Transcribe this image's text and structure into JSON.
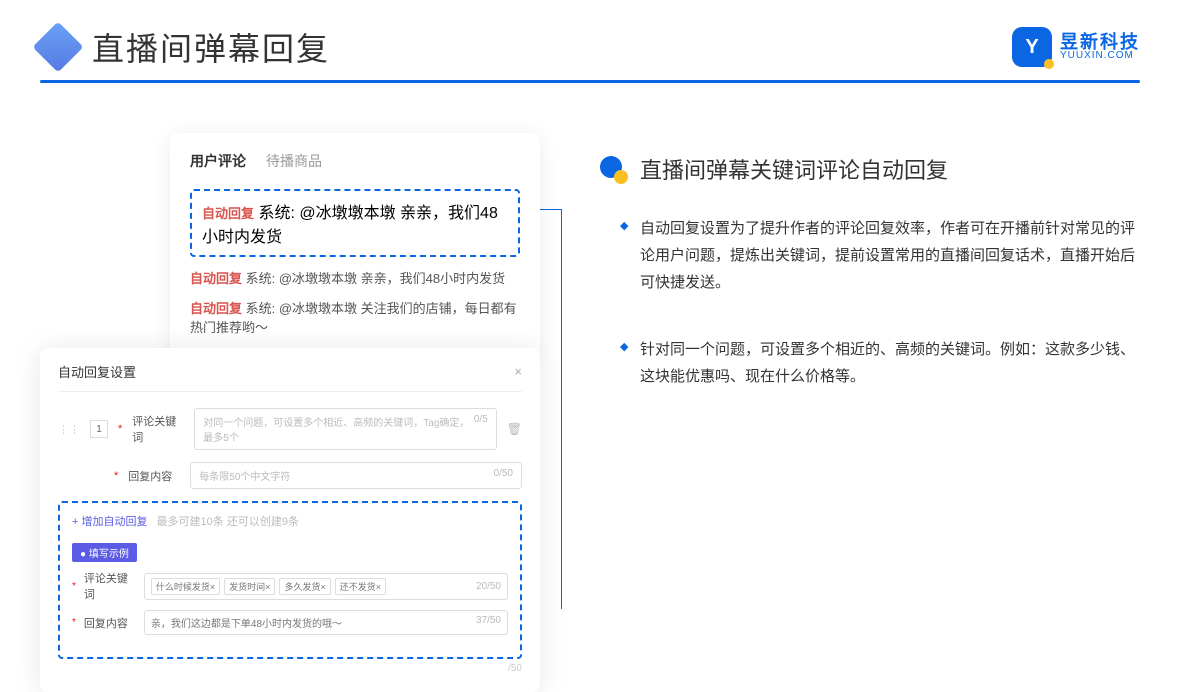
{
  "header": {
    "title": "直播间弹幕回复",
    "logo_cn": "昱新科技",
    "logo_en": "YUUXIN.COM",
    "logo_letter": "Y"
  },
  "cardTop": {
    "tab_active": "用户评论",
    "tab_inactive": "待播商品",
    "dashed_badge": "自动回复",
    "dashed_text": "系统: @冰墩墩本墩 亲亲，我们48小时内发货",
    "line2_badge": "自动回复",
    "line2_text": "系统: @冰墩墩本墩 亲亲，我们48小时内发货",
    "line3_badge": "自动回复",
    "line3_text": "系统: @冰墩墩本墩 关注我们的店铺，每日都有热门推荐哟～"
  },
  "cardBottom": {
    "modal_title": "自动回复设置",
    "row_num": "1",
    "label1": "评论关键词",
    "placeholder1": "对同一个问题，可设置多个相近、高频的关键词，Tag确定，最多5个",
    "counter1": "0/5",
    "label2": "回复内容",
    "placeholder2": "每条限50个中文字符",
    "counter2": "0/50",
    "add_link": "+ 增加自动回复",
    "add_hint": "最多可建10条 还可以创建9条",
    "example_tag": "● 填写示例",
    "ex_label1": "评论关键词",
    "ex_tags": [
      "什么时候发货×",
      "发货时间×",
      "多久发货×",
      "还不发货×"
    ],
    "ex_counter1": "20/50",
    "ex_label2": "回复内容",
    "ex_reply": "亲，我们这边都是下单48小时内发货的哦～",
    "ex_counter2": "37/50",
    "outer_counter": "/50"
  },
  "right": {
    "subtitle": "直播间弹幕关键词评论自动回复",
    "bullet1": "自动回复设置为了提升作者的评论回复效率，作者可在开播前针对常见的评论用户问题，提炼出关键词，提前设置常用的直播间回复话术，直播开始后可快捷发送。",
    "bullet2": "针对同一个问题，可设置多个相近的、高频的关键词。例如：这款多少钱、这块能优惠吗、现在什么价格等。"
  }
}
